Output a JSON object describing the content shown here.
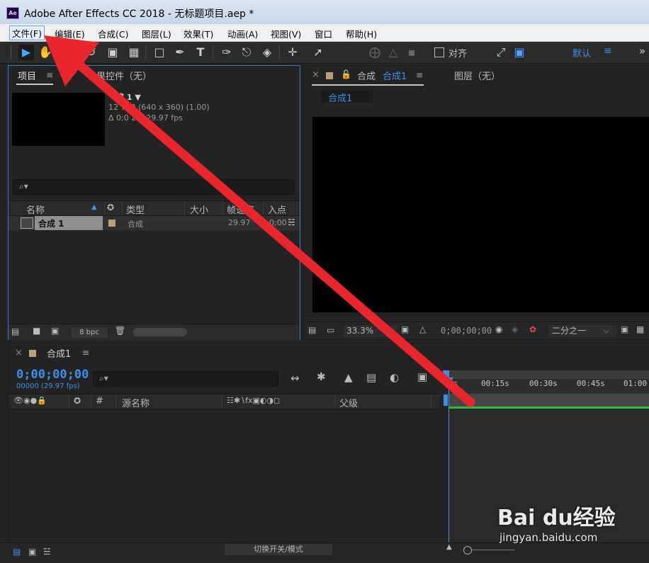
{
  "window": {
    "logo": "Ae",
    "title": "Adobe After Effects CC 2018 - 无标题项目.aep *"
  },
  "menu": [
    "文件(F)",
    "编辑(E)",
    "合成(C)",
    "图层(L)",
    "效果(T)",
    "动画(A)",
    "视图(V)",
    "窗口",
    "帮助(H)"
  ],
  "toolbar": {
    "align_label": "对齐",
    "workspace": "默认",
    "overflow": "»"
  },
  "project": {
    "tab_label": "项目",
    "effects_tab": "果控件（无）",
    "comp_name": "成 1 ▼",
    "comp_size": "12 720 (640 x 360) (1.00)",
    "comp_dur": "Δ 0;0 28, 29.97 fps",
    "search_glyph": "⌕▾",
    "columns": [
      "名称",
      "类型",
      "大小",
      "帧速率",
      "入点"
    ],
    "row": {
      "name": "合成 1",
      "type": "合成",
      "fps": "29.97",
      "inpoint": "0;00"
    },
    "bpc": "8 bpc"
  },
  "composition": {
    "tab_prefix": "合成",
    "tab_comp": "合成1",
    "subtab": "合成1",
    "layer_tab": "图层（无）",
    "zoom": "33.3%",
    "timecode": "0;00;00;00",
    "resolution": "二分之一"
  },
  "timeline": {
    "tab": "合成1",
    "timecode": "0;00;00;00",
    "frames": "00000 (29.97 fps)",
    "search_glyph": "⌕▾",
    "col_num": "#",
    "col_source": "源名称",
    "col_parent": "父级",
    "ticks": [
      "0s",
      "00:15s",
      "00:30s",
      "00:45s",
      "01:00"
    ],
    "switch_label": "切换开关/模式"
  },
  "watermark": {
    "brand": "Bai du经验",
    "url": "jingyan.baidu.com"
  },
  "colors": {
    "accent": "#3f8fe8",
    "arrow": "#e8262b",
    "green": "#30b83a"
  }
}
